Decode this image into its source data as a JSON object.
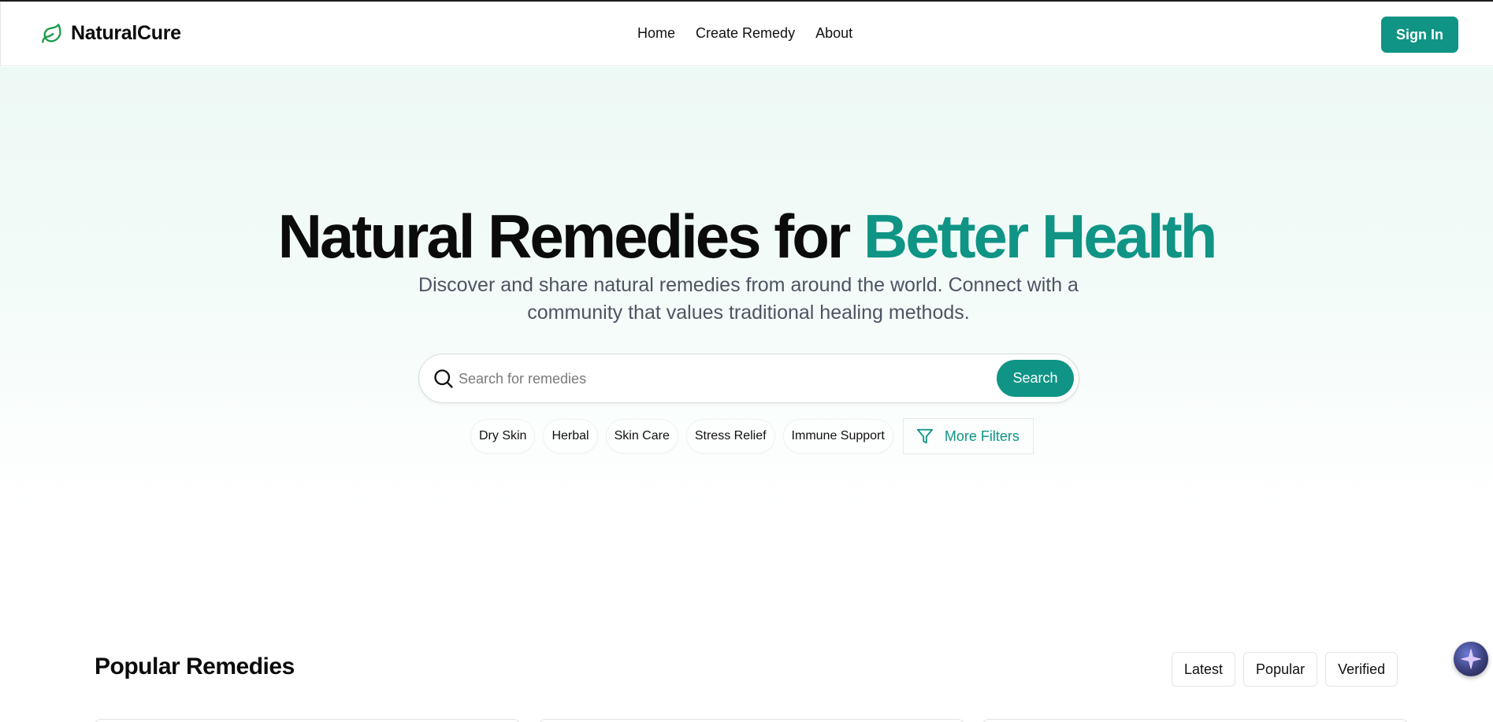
{
  "header": {
    "brand": "NaturalCure",
    "nav": [
      "Home",
      "Create Remedy",
      "About"
    ],
    "sign_in": "Sign In"
  },
  "hero": {
    "title_main": "Natural Remedies for ",
    "title_accent": "Better Health",
    "subtitle": "Discover and share natural remedies from around the world. Connect with a community that values traditional healing methods."
  },
  "search": {
    "placeholder": "Search for remedies",
    "value": "",
    "button": "Search"
  },
  "chips": [
    "Dry Skin",
    "Herbal",
    "Skin Care",
    "Stress Relief",
    "Immune Support"
  ],
  "more_filters": "More Filters",
  "popular": {
    "title": "Popular Remedies",
    "tabs": [
      "Latest",
      "Popular",
      "Verified"
    ]
  },
  "colors": {
    "accent": "#0f9485",
    "logo_green": "#1a9a4a"
  },
  "icons": {
    "logo": "leaf-icon",
    "search": "search-icon",
    "filter": "filter-icon",
    "assistant": "sparkle-icon"
  }
}
